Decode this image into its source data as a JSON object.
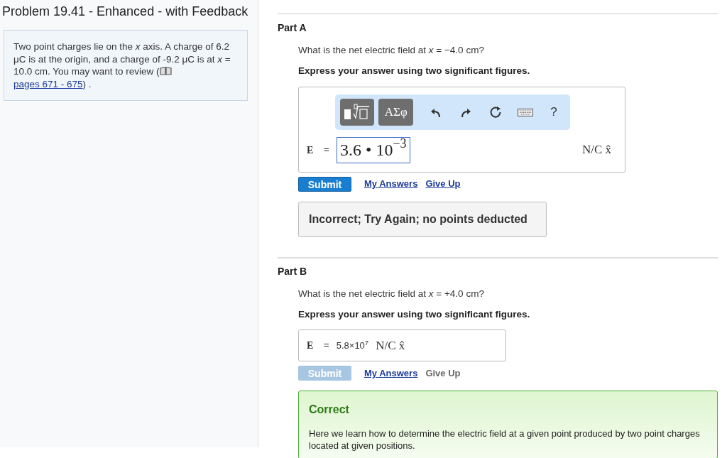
{
  "problem": {
    "title": "Problem 19.41 - Enhanced - with Feedback",
    "text": "Two point charges lie on the *x* axis. A charge of 6.2 μC is at the origin, and a charge of -9.2 μC is at *x* = 10.0 cm. You may want to review (",
    "link": "pages 671 - 675",
    "text_after": ") ."
  },
  "parts": [
    {
      "title": "Part A",
      "question": "What is the net electric field at *x* = −4.0 cm?",
      "instruction": "Express your answer using two significant figures.",
      "kind": "editor",
      "toolbar": {
        "symbols_button": "ΑΣφ",
        "help_button": "?"
      },
      "variable": "E⃗ =",
      "answer": "3.6 • 10$^{−3}$",
      "units": "N/C x̂",
      "submit": {
        "label": "Submit",
        "disabled": false
      },
      "my_answers": "My Answers",
      "give_up": {
        "label": "Give Up",
        "disabled": false
      },
      "feedback": {
        "kind": "incorrect",
        "title": "Incorrect; Try Again; no points deducted"
      }
    },
    {
      "title": "Part B",
      "question": "What is the net electric field at *x* = +4.0 cm?",
      "instruction": "Express your answer using two significant figures.",
      "kind": "static",
      "variable": "E⃗ =",
      "answer": "5.8×10$^{7}$",
      "units": "N/C x̂",
      "submit": {
        "label": "Submit",
        "disabled": true
      },
      "my_answers": "My Answers",
      "give_up": {
        "label": "Give Up",
        "disabled": true
      },
      "feedback": {
        "kind": "correct",
        "title": "Correct",
        "text": "Here we learn how to determine the electric field at a given point produced by two point charges located at given positions."
      }
    }
  ]
}
